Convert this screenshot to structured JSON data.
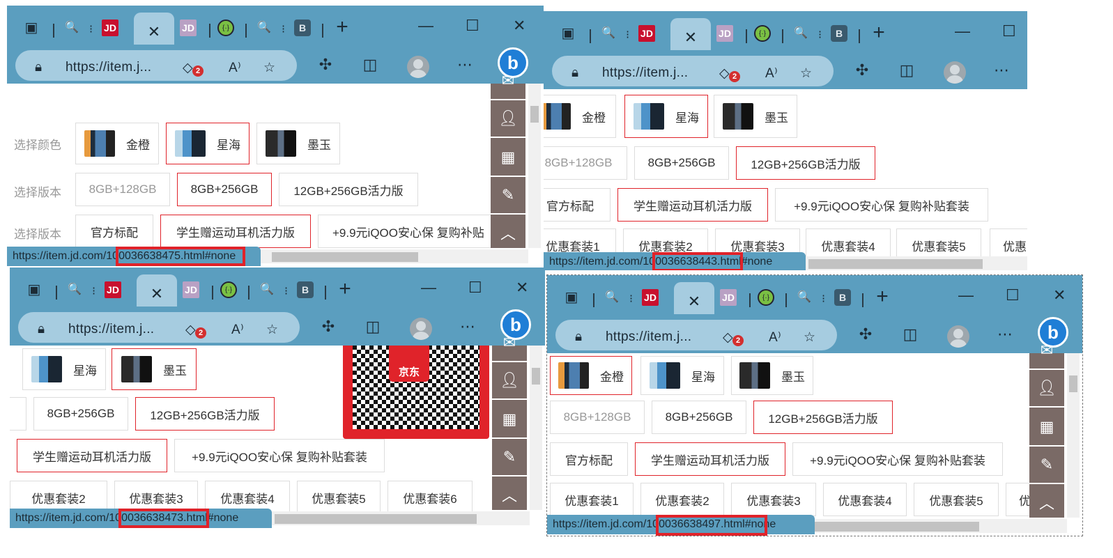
{
  "browser": {
    "address_text": "https://item.j...",
    "tracking_badge": "2",
    "bing_label": "b",
    "b_tab_label": "B",
    "jd_tab_label": "JD",
    "new_tab_icon": "+",
    "close_tab_icon": "✕"
  },
  "product": {
    "color_label": "选择颜色",
    "version_label": "选择版本",
    "colors": [
      "金橙",
      "星海",
      "墨玉"
    ],
    "versions": [
      "8GB+128GB",
      "8GB+256GB",
      "12GB+256GB活力版"
    ],
    "bundles": [
      "官方标配",
      "学生赠运动耳机活力版",
      "+9.9元iQOO安心保 复购补贴套装"
    ],
    "packages": [
      "优惠套装1",
      "优惠套装2",
      "优惠套装3",
      "优惠套装4",
      "优惠套装5",
      "优惠套装6"
    ],
    "package_cut": "优惠",
    "bundle_cut": "+9.9元iQOO安心保 复购补贴",
    "version_cut": "8GB+128GB",
    "qr_logo": "京东"
  },
  "windows": [
    {
      "status_prefix": "https://item.jd.com/",
      "status_id": "100036638475.html#none",
      "status_suffix": ""
    },
    {
      "status_prefix": "https://item.jd.com/",
      "status_id": "100036638443.",
      "status_suffix": "html#none"
    },
    {
      "status_prefix": "https://item.jd.com/",
      "status_id": "100036638473.",
      "status_suffix": "html#none"
    },
    {
      "status_prefix": "https://item.jd.com/",
      "status_id": "100036638497.htm",
      "status_suffix": "l#none"
    }
  ]
}
